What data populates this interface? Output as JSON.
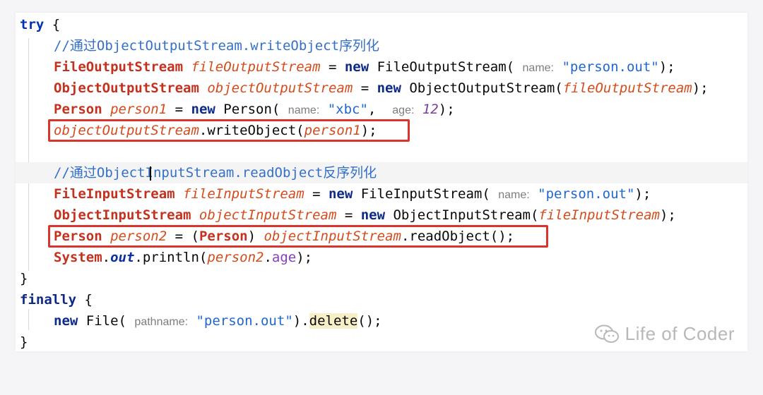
{
  "watermark": {
    "text": "Life of Coder",
    "icon": "wechat-icon"
  },
  "colors": {
    "highlight_box": "#d9352c",
    "keyword": "#0033b3",
    "string": "#1f66d1",
    "variable": "#d64b1c",
    "comment": "#3470c9"
  },
  "code": {
    "l1": {
      "kw": "try",
      "rest": " {"
    },
    "l2": {
      "comment": "//通过ObjectOutputStream.writeObject序列化"
    },
    "l3": {
      "type": "FileOutputStream",
      "var": "fileOutputStream",
      "eq": " = ",
      "kw_new": "new",
      "call": " FileOutputStream(",
      "hint": "name:",
      "str": "\"person.out\"",
      "end": ");"
    },
    "l4": {
      "type": "ObjectOutputStream",
      "var": "objectOutputStream",
      "eq": " = ",
      "kw_new": "new",
      "call": " ObjectOutputStream(",
      "arg": "fileOutputStream",
      "end": ");"
    },
    "l5": {
      "type": "Person",
      "var": "person1",
      "eq": " = ",
      "kw_new": "new",
      "call": " Person(",
      "hint1": "name:",
      "str": "\"xbc\"",
      "sep": ", ",
      "hint2": "age:",
      "num": "12",
      "end": ");"
    },
    "l6": {
      "var": "objectOutputStream",
      "call": ".writeObject(",
      "arg": "person1",
      "end": ");"
    },
    "l8": {
      "comment1": "//通过Object",
      "comment2": "InputStream.readObject反序列化"
    },
    "l9": {
      "type": "FileInputStream",
      "var": "fileInputStream",
      "eq": " = ",
      "kw_new": "new",
      "call": " FileInputStream(",
      "hint": "name:",
      "str": "\"person.out\"",
      "end": ");"
    },
    "l10": {
      "type": "ObjectInputStream",
      "var": "objectInputStream",
      "eq": " = ",
      "kw_new": "new",
      "call": " ObjectInputStream(",
      "arg": "fileInputStream",
      "end": ");"
    },
    "l11": {
      "type": "Person",
      "var": "person2",
      "eq": " = (",
      "cast": "Person",
      "cast_end": ") ",
      "var2": "objectInputStream",
      "call": ".readObject();"
    },
    "l12": {
      "cls": "System",
      "dot": ".",
      "field": "out",
      "call": ".println(",
      "var": "person2",
      "dot2": ".",
      "fld": "age",
      "end": ");"
    },
    "l13": {
      "text": "}"
    },
    "l14": {
      "kw": "finally",
      "rest": " {"
    },
    "l15": {
      "kw_new": "new",
      "call": " File(",
      "hint": "pathname:",
      "str": "\"person.out\"",
      "mid": ").",
      "method": "delete",
      "end": "();"
    },
    "l16": {
      "text": "}"
    }
  }
}
